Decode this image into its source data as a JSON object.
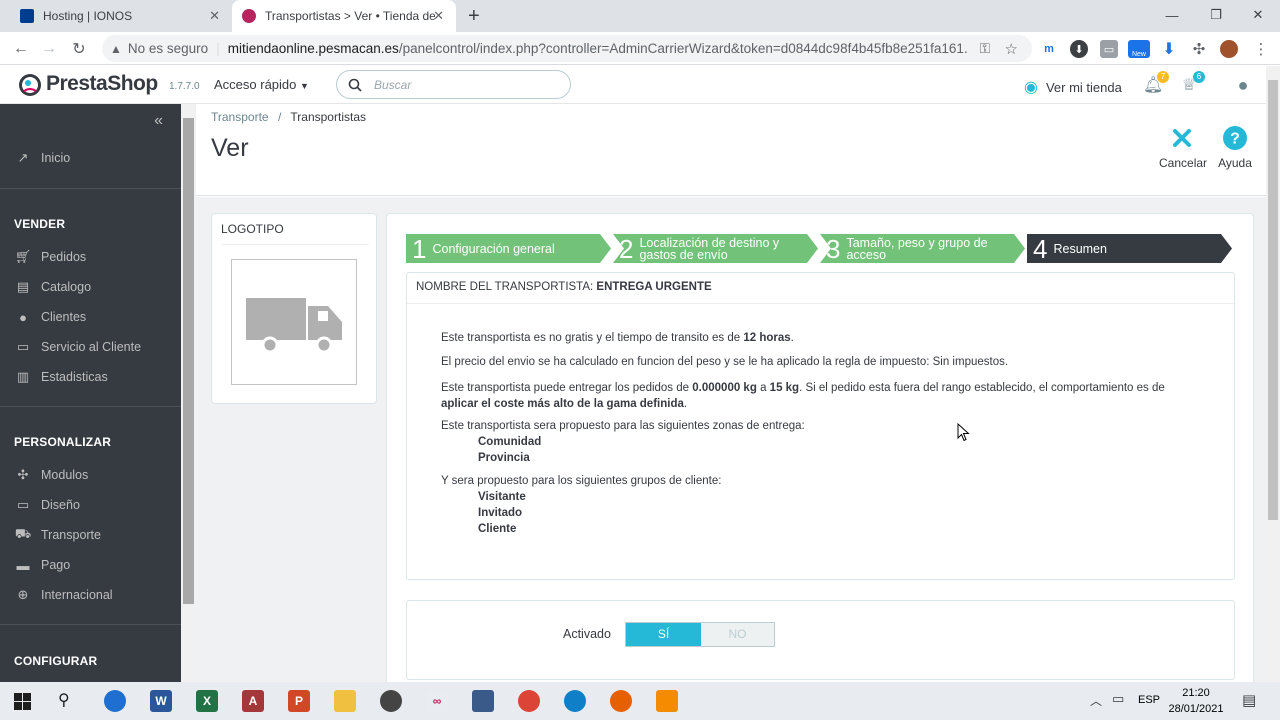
{
  "browser": {
    "tabs": [
      {
        "title": "Hosting | IONOS",
        "active": false,
        "favicon_color": "#003d8f"
      },
      {
        "title": "Transportistas > Ver • Tienda de",
        "active": true,
        "favicon_color": "#b6255e"
      }
    ],
    "new_tab_label": "+",
    "security_label": "No es seguro",
    "url_host": "mitiendaonline.pesmacan.es",
    "url_path": "/panelcontrol/index.php?controller=AdminCarrierWizard&token=d0844dc98f4b45fb8e251fa161...",
    "new_badge": "New"
  },
  "header": {
    "logo_text": "PrestaShop",
    "version": "1.7.7.0",
    "quick_access": "Acceso rápido",
    "search_placeholder": "Buscar",
    "view_store": "Ver mi tienda",
    "notif_count_1": "7",
    "notif_count_2": "6",
    "accent": "#25b9d7"
  },
  "sidebar": {
    "home": "Inicio",
    "sections": {
      "sell": "VENDER",
      "customize": "PERSONALIZAR",
      "configure": "CONFIGURAR"
    },
    "sell_items": [
      "Pedidos",
      "Catalogo",
      "Clientes",
      "Servicio al Cliente",
      "Estadisticas"
    ],
    "customize_items": [
      "Modulos",
      "Diseño",
      "Transporte",
      "Pago",
      "Internacional"
    ]
  },
  "page": {
    "breadcrumb_parent": "Transporte",
    "breadcrumb_current": "Transportistas",
    "title": "Ver",
    "cancel_label": "Cancelar",
    "help_label": "Ayuda"
  },
  "logo_panel": {
    "heading": "LOGOTIPO"
  },
  "wizard": {
    "steps": [
      {
        "num": "1",
        "label": "Configuración general",
        "color": "#72c279"
      },
      {
        "num": "2",
        "label": "Localización de destino y gastos de envío",
        "color": "#72c279"
      },
      {
        "num": "3",
        "label": "Tamaño, peso y grupo de acceso",
        "color": "#72c279"
      },
      {
        "num": "4",
        "label": "Resumen",
        "color": "#363a41"
      }
    ]
  },
  "summary": {
    "carrier_name_label": "NOMBRE DEL TRANSPORTISTA:",
    "carrier_name": "ENTREGA URGENTE",
    "line1_a": "Este transportista es no gratis y el tiempo de transito es de",
    "line1_b": "12 horas",
    "line1_c": ".",
    "line2": "El precio del envio se ha calculado en funcion del peso y se le ha aplicado la regla de impuesto: Sin impuestos.",
    "line3_a": "Este transportista puede entregar los pedidos de",
    "line3_b": "0.000000 kg",
    "line3_c": "a",
    "line3_d": "15 kg",
    "line3_e": ". Si el pedido esta fuera del rango establecido, el comportamiento es de",
    "line3_f": "aplicar el coste más alto de la gama definida",
    "line3_g": ".",
    "zones_intro": "Este transportista sera propuesto para las siguientes zonas de entrega:",
    "zones": [
      "Comunidad",
      "Provincia"
    ],
    "groups_intro": "Y sera propuesto para los siguientes grupos de cliente:",
    "groups": [
      "Visitante",
      "Invitado",
      "Cliente"
    ]
  },
  "active_toggle": {
    "label": "Activado",
    "yes": "SÍ",
    "no": "NO",
    "value": "SÍ"
  },
  "taskbar": {
    "lang": "ESP",
    "time": "21:20",
    "date": "28/01/2021"
  }
}
